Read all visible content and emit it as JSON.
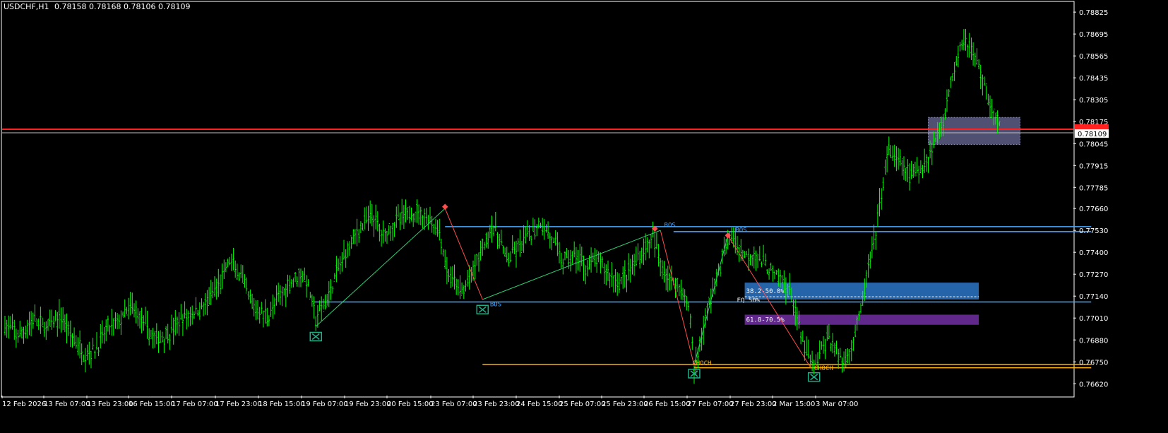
{
  "header": {
    "symbol": "USDCHF,H1",
    "ohlc": "0.78158 0.78168 0.78106 0.78109"
  },
  "colors": {
    "background": "#000000",
    "frame": "#ffffff",
    "candle": "#00ff00",
    "zone_blue": "#2a6fbd",
    "zone_purple": "#6a2c9a",
    "zone_grey": "#6b6b9a",
    "level_blue": "#4aa8ff",
    "level_orange": "#ffb300",
    "current_price": "#ff2020",
    "swing_green": "#2ecc71",
    "swing_red": "#ff4d4d",
    "marker": "#1fb08a"
  },
  "chart_data": {
    "type": "candlestick",
    "symbol": "USDCHF",
    "timeframe": "H1",
    "ylim": [
      0.7655,
      0.7888
    ],
    "y_ticks": [
      "0.78825",
      "0.78695",
      "0.78565",
      "0.78435",
      "0.78305",
      "0.78175",
      "0.78045",
      "0.77915",
      "0.77785",
      "0.77660",
      "0.77530",
      "0.77400",
      "0.77270",
      "0.77140",
      "0.77010",
      "0.76880",
      "0.76750",
      "0.76620"
    ],
    "x_ticks": [
      "12 Feb 2026",
      "13 Feb 07:00",
      "13 Feb 23:00",
      "16 Feb 15:00",
      "17 Feb 07:00",
      "17 Feb 23:00",
      "18 Feb 15:00",
      "19 Feb 07:00",
      "19 Feb 23:00",
      "20 Feb 15:00",
      "23 Feb 07:00",
      "23 Feb 23:00",
      "24 Feb 15:00",
      "25 Feb 07:00",
      "25 Feb 23:00",
      "26 Feb 15:00",
      "27 Feb 07:00",
      "27 Feb 23:00",
      "2 Mar 15:00",
      "3 Mar 07:00"
    ],
    "current_price": "0.78109",
    "red_line_price": 0.7813,
    "price_path": [
      [
        0,
        0.7697
      ],
      [
        8,
        0.769
      ],
      [
        15,
        0.77
      ],
      [
        22,
        0.7695
      ],
      [
        30,
        0.7702
      ],
      [
        36,
        0.769
      ],
      [
        42,
        0.768
      ],
      [
        48,
        0.7682
      ],
      [
        55,
        0.7695
      ],
      [
        62,
        0.77
      ],
      [
        68,
        0.7708
      ],
      [
        74,
        0.7698
      ],
      [
        80,
        0.7688
      ],
      [
        88,
        0.7692
      ],
      [
        94,
        0.77
      ],
      [
        102,
        0.7705
      ],
      [
        108,
        0.771
      ],
      [
        114,
        0.772
      ],
      [
        120,
        0.7735
      ],
      [
        126,
        0.7725
      ],
      [
        132,
        0.7708
      ],
      [
        140,
        0.7702
      ],
      [
        146,
        0.7712
      ],
      [
        152,
        0.7722
      ],
      [
        158,
        0.7728
      ],
      [
        162,
        0.772
      ],
      [
        166,
        0.77
      ],
      [
        172,
        0.7712
      ],
      [
        178,
        0.773
      ],
      [
        184,
        0.7745
      ],
      [
        190,
        0.7755
      ],
      [
        196,
        0.7762
      ],
      [
        202,
        0.775
      ],
      [
        208,
        0.7758
      ],
      [
        214,
        0.7762
      ],
      [
        220,
        0.7764
      ],
      [
        226,
        0.776
      ],
      [
        232,
        0.7752
      ],
      [
        236,
        0.7728
      ],
      [
        240,
        0.7722
      ],
      [
        244,
        0.7716
      ],
      [
        248,
        0.7724
      ],
      [
        254,
        0.774
      ],
      [
        260,
        0.7756
      ],
      [
        264,
        0.7748
      ],
      [
        268,
        0.7735
      ],
      [
        274,
        0.7742
      ],
      [
        280,
        0.775
      ],
      [
        286,
        0.7758
      ],
      [
        292,
        0.7748
      ],
      [
        298,
        0.7735
      ],
      [
        304,
        0.7738
      ],
      [
        310,
        0.7732
      ],
      [
        316,
        0.7735
      ],
      [
        322,
        0.7728
      ],
      [
        328,
        0.7722
      ],
      [
        334,
        0.773
      ],
      [
        340,
        0.774
      ],
      [
        346,
        0.7748
      ],
      [
        350,
        0.7735
      ],
      [
        354,
        0.7725
      ],
      [
        358,
        0.7722
      ],
      [
        362,
        0.7718
      ],
      [
        366,
        0.77
      ],
      [
        368,
        0.767
      ],
      [
        372,
        0.769
      ],
      [
        376,
        0.771
      ],
      [
        380,
        0.7725
      ],
      [
        384,
        0.774
      ],
      [
        388,
        0.775
      ],
      [
        392,
        0.7742
      ],
      [
        396,
        0.7738
      ],
      [
        400,
        0.774
      ],
      [
        404,
        0.7734
      ],
      [
        408,
        0.773
      ],
      [
        412,
        0.7725
      ],
      [
        416,
        0.7722
      ],
      [
        420,
        0.7715
      ],
      [
        424,
        0.7695
      ],
      [
        428,
        0.768
      ],
      [
        432,
        0.7672
      ],
      [
        436,
        0.7682
      ],
      [
        440,
        0.769
      ],
      [
        444,
        0.768
      ],
      [
        448,
        0.7675
      ],
      [
        452,
        0.7685
      ],
      [
        456,
        0.77
      ],
      [
        460,
        0.7725
      ],
      [
        464,
        0.7745
      ],
      [
        468,
        0.7775
      ],
      [
        472,
        0.78
      ],
      [
        476,
        0.7795
      ],
      [
        480,
        0.779
      ],
      [
        484,
        0.7785
      ],
      [
        488,
        0.7788
      ],
      [
        492,
        0.7795
      ],
      [
        496,
        0.7805
      ],
      [
        500,
        0.7815
      ],
      [
        504,
        0.7835
      ],
      [
        508,
        0.7855
      ],
      [
        512,
        0.7868
      ],
      [
        516,
        0.786
      ],
      [
        520,
        0.785
      ],
      [
        524,
        0.7835
      ],
      [
        528,
        0.7822
      ],
      [
        532,
        0.7812
      ]
    ],
    "n_bars": 532,
    "zones": [
      {
        "id": "supply-zone",
        "label": "",
        "x0": 493,
        "x1": 542,
        "top": 0.782,
        "bottom": 0.7804,
        "color": "#6b6b9a"
      },
      {
        "id": "fib-zone-upper",
        "label": "38.2-50.0%",
        "x0": 395,
        "x1": 520,
        "top": 0.7722,
        "bottom": 0.7712,
        "color": "#2a6fbd"
      },
      {
        "id": "fib-zone-lower",
        "label": "61.8-70.5%",
        "x0": 395,
        "x1": 520,
        "top": 0.7703,
        "bottom": 0.7697,
        "color": "#6a2c9a"
      }
    ],
    "levels": [
      {
        "id": "level-1",
        "price": 0.77552,
        "x0": 235,
        "x1": 580,
        "color": "#4aa8ff"
      },
      {
        "id": "level-2",
        "price": 0.77523,
        "x0": 357,
        "x1": 580,
        "color": "#4aa8ff"
      },
      {
        "id": "level-3",
        "price": 0.77105,
        "x0": 165,
        "x1": 580,
        "color": "#4aa8ff"
      },
      {
        "id": "level-4",
        "price": 0.76735,
        "x0": 255,
        "x1": 580,
        "color": "#ffb300"
      },
      {
        "id": "level-5",
        "price": 0.76715,
        "x0": 368,
        "x1": 580,
        "color": "#ffb300"
      }
    ],
    "eq_line": {
      "label": "EQ 50%",
      "price": 0.77136,
      "x0": 395,
      "x1": 520
    },
    "annotations": [
      {
        "text": "BOS",
        "x": 259,
        "price": 0.7708,
        "color": "#4aa8ff"
      },
      {
        "text": "BOS",
        "x": 352,
        "price": 0.7755,
        "color": "#4aa8ff"
      },
      {
        "text": "BOS",
        "x": 390,
        "price": 0.7752,
        "color": "#4aa8ff"
      },
      {
        "text": "CHOCH",
        "x": 367,
        "price": 0.7673,
        "color": "#ffb300"
      },
      {
        "text": "CHOCH",
        "x": 432,
        "price": 0.767,
        "color": "#ffb300"
      }
    ],
    "markers": [
      {
        "x": 166,
        "price": 0.769
      },
      {
        "x": 255,
        "price": 0.7706
      },
      {
        "x": 368,
        "price": 0.7668
      },
      {
        "x": 432,
        "price": 0.7666
      }
    ],
    "swing_lines": [
      {
        "color": "#2ecc71",
        "pts": [
          [
            166,
            0.7696
          ],
          [
            235,
            0.7766
          ]
        ]
      },
      {
        "color": "#ff4d4d",
        "pts": [
          [
            235,
            0.7766
          ],
          [
            255,
            0.7712
          ]
        ]
      },
      {
        "color": "#2ecc71",
        "pts": [
          [
            255,
            0.7712
          ],
          [
            350,
            0.7753
          ]
        ]
      },
      {
        "color": "#ff4d4d",
        "pts": [
          [
            350,
            0.7753
          ],
          [
            368,
            0.7673
          ]
        ]
      },
      {
        "color": "#2ecc71",
        "pts": [
          [
            368,
            0.7673
          ],
          [
            386,
            0.775
          ]
        ]
      },
      {
        "color": "#ff4d4d",
        "pts": [
          [
            386,
            0.775
          ],
          [
            430,
            0.7672
          ]
        ]
      }
    ],
    "swing_points": [
      {
        "x": 235,
        "price": 0.7767
      },
      {
        "x": 347,
        "price": 0.7754
      },
      {
        "x": 386,
        "price": 0.775
      }
    ]
  }
}
